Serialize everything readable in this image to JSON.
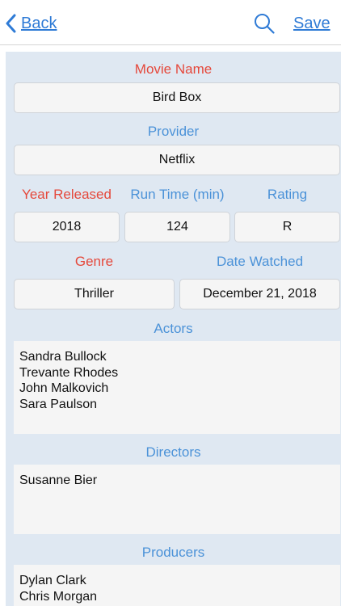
{
  "nav": {
    "back_label": "Back",
    "save_label": "Save"
  },
  "movie": {
    "name_label": "Movie Name",
    "name_value": "Bird Box",
    "provider_label": "Provider",
    "provider_value": "Netflix",
    "year_label": "Year Released",
    "year_value": "2018",
    "runtime_label": "Run Time (min)",
    "runtime_value": "124",
    "rating_label": "Rating",
    "rating_value": "R",
    "genre_label": "Genre",
    "genre_value": "Thriller",
    "date_label": "Date Watched",
    "date_value": "December 21, 2018",
    "actors_label": "Actors",
    "actors": [
      "Sandra Bullock",
      "Trevante Rhodes",
      "John Malkovich",
      "Sara Paulson"
    ],
    "directors_label": "Directors",
    "directors": [
      "Susanne Bier"
    ],
    "producers_label": "Producers",
    "producers": [
      "Dylan Clark",
      "Chris Morgan"
    ]
  },
  "colors": {
    "accent": "#2f7bd6",
    "label_red": "#e5483b",
    "label_blue": "#4b92d8",
    "panel_bg": "#dfe8f2"
  },
  "icons": {
    "back": "chevron-left-icon",
    "search": "search-icon"
  }
}
